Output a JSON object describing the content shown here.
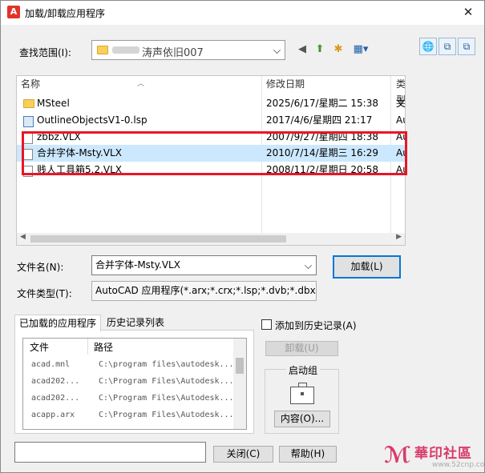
{
  "window": {
    "title": "加载/卸载应用程序",
    "close": "✕",
    "app_icon": "A"
  },
  "lookin": {
    "label": "查找范围(I):",
    "value": "涛声依旧007"
  },
  "toolbar": {
    "back": "◀",
    "up": "⬆",
    "new_folder": "✱",
    "views": "▦▾"
  },
  "right_tools": [
    "🌐",
    "⧉",
    "⧉"
  ],
  "file_list": {
    "headers": {
      "name": "名称",
      "date": "修改日期",
      "type": "类型"
    },
    "rows": [
      {
        "name": "MSteel",
        "date": "2025/6/17/星期二 15:38",
        "type": "文",
        "icon": "folder-icon",
        "selected": false
      },
      {
        "name": "OutlineObjectsV1-0.lsp",
        "date": "2017/4/6/星期四 21:17",
        "type": "Au",
        "icon": "lsp-file-icon",
        "selected": false
      },
      {
        "name": "zbbz.VLX",
        "date": "2007/9/27/星期四 18:38",
        "type": "Au",
        "icon": "vlx-file-icon",
        "selected": false
      },
      {
        "name": "合并字体-Msty.VLX",
        "date": "2010/7/14/星期三 16:29",
        "type": "Au",
        "icon": "vlx-file-icon",
        "selected": true
      },
      {
        "name": "贱人工具箱5.2.VLX",
        "date": "2008/11/2/星期日 20:58",
        "type": "Au",
        "icon": "vlx-file-icon",
        "selected": false
      }
    ]
  },
  "filename": {
    "label": "文件名(N):",
    "value": "合并字体-Msty.VLX"
  },
  "filetype": {
    "label": "文件类型(T):",
    "value": "AutoCAD 应用程序(*.arx;*.crx;*.lsp;*.dvb;*.dbx"
  },
  "load_button": "加载(L)",
  "tabs": {
    "loaded": "已加载的应用程序",
    "history": "历史记录列表"
  },
  "loaded_list": {
    "headers": {
      "file": "文件",
      "path": "路径"
    },
    "rows": [
      {
        "file": "acad.mnl",
        "path": "C:\\program files\\autodesk..."
      },
      {
        "file": "acad202...",
        "path": "C:\\Program Files\\Autodesk..."
      },
      {
        "file": "acad202...",
        "path": "C:\\Program Files\\Autodesk..."
      },
      {
        "file": "acapp.arx",
        "path": "C:\\Program Files\\Autodesk..."
      }
    ]
  },
  "add_history": "添加到历史记录(A)",
  "unload_button": "卸载(U)",
  "startup_group": {
    "title": "启动组",
    "contents_button": "内容(O)..."
  },
  "close_button": "关闭(C)",
  "help_button": "帮助(H)",
  "watermark": {
    "text": "華印社區",
    "url": "www.52cnp.com"
  },
  "colors": {
    "highlight": "#e81626",
    "selection": "#cce8ff",
    "accent": "#0078d7"
  }
}
